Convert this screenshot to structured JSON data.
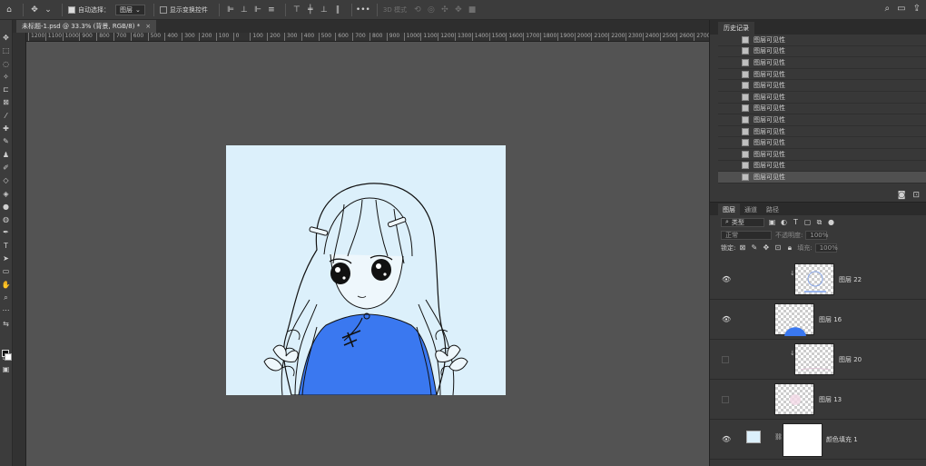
{
  "options_bar": {
    "auto_select_label": "自动选择：",
    "auto_select_value": "图层",
    "transform_controls_label": "显示变换控件",
    "mode_3d_label": "3D 模式"
  },
  "document": {
    "tab_title": "未标题-1.psd @ 33.3% (背景, RGB/8) *",
    "close": "×"
  },
  "ruler_h_ticks": [
    "1200",
    "1100",
    "1000",
    "900",
    "800",
    "700",
    "600",
    "500",
    "400",
    "300",
    "200",
    "100",
    "0",
    "100",
    "200",
    "300",
    "400",
    "500",
    "600",
    "700",
    "800",
    "900",
    "1000",
    "1100",
    "1200",
    "1300",
    "1400",
    "1500",
    "1600",
    "1700",
    "1800",
    "1900",
    "2000",
    "2100",
    "2200",
    "2300",
    "2400",
    "2500",
    "2600",
    "2700",
    "2800"
  ],
  "history": {
    "tab_label": "历史记录",
    "items": [
      "图层可见性",
      "图层可见性",
      "图层可见性",
      "图层可见性",
      "图层可见性",
      "图层可见性",
      "图层可见性",
      "图层可见性",
      "图层可见性",
      "图层可见性",
      "图层可见性",
      "图层可见性",
      "图层可见性"
    ],
    "selected_index": 12
  },
  "layers_panel": {
    "tabs": [
      "图层",
      "通道",
      "路径"
    ],
    "kind_filter": "类型",
    "blend_mode": "正常",
    "opacity_label": "不透明度:",
    "opacity_value": "100%",
    "lock_label": "锁定:",
    "fill_label": "填充:",
    "fill_value": "100%",
    "layers": [
      {
        "name": "图层 22",
        "visible": true,
        "clipped": true
      },
      {
        "name": "图层 16",
        "visible": true,
        "clipped": false
      },
      {
        "name": "图层 20",
        "visible": false,
        "clipped": true
      },
      {
        "name": "图层 13",
        "visible": false,
        "clipped": false
      },
      {
        "name": "颜色填充 1",
        "visible": true,
        "clipped": false
      }
    ]
  },
  "colors": {
    "canvas_bg": "#dcf0fb",
    "dress_blue": "#3a78f0",
    "ui_dark": "#383838"
  }
}
